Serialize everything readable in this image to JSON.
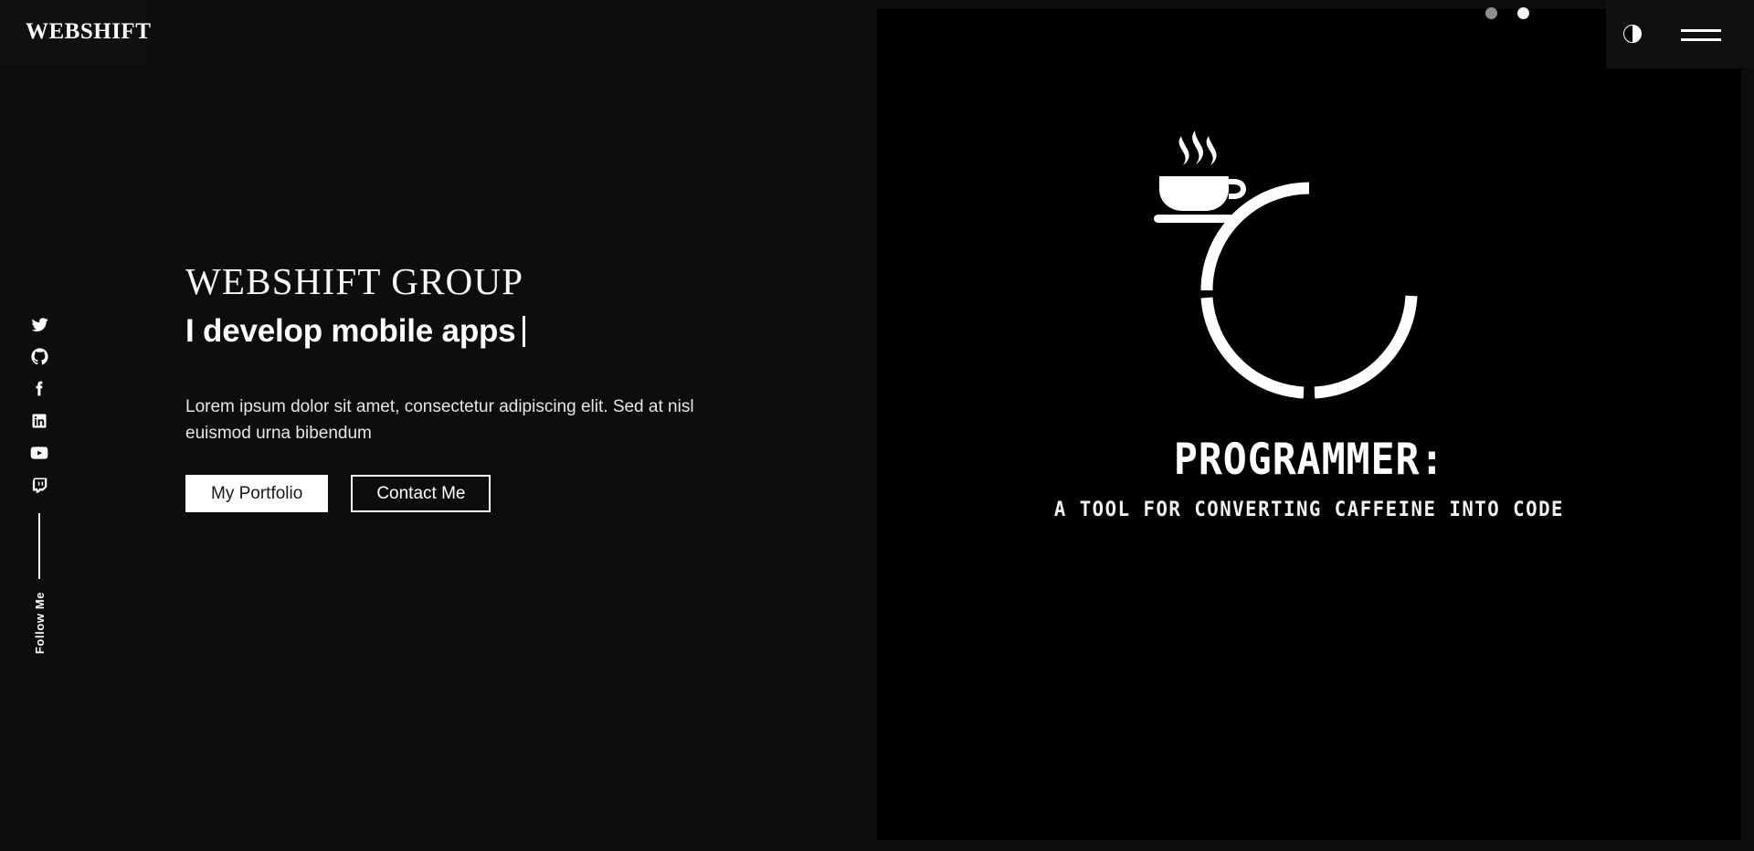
{
  "brand": {
    "logo_text": "WEBSHIFT"
  },
  "header": {
    "theme_toggle_icon": "contrast-toggle-icon",
    "menu_icon": "hamburger-menu-icon",
    "carousel_dots": [
      {
        "name": "carousel-dot-1",
        "active": false,
        "color": "#8d8d8d"
      },
      {
        "name": "carousel-dot-2",
        "active": true,
        "color": "#f2f2f2"
      }
    ]
  },
  "social": {
    "label": "Follow Me",
    "items": [
      {
        "name": "twitter",
        "icon": "twitter-icon"
      },
      {
        "name": "github",
        "icon": "github-icon"
      },
      {
        "name": "facebook",
        "icon": "facebook-icon"
      },
      {
        "name": "linkedin",
        "icon": "linkedin-icon"
      },
      {
        "name": "youtube",
        "icon": "youtube-icon"
      },
      {
        "name": "twitch",
        "icon": "twitch-icon"
      }
    ]
  },
  "hero": {
    "kicker": "WEBSHIFT GROUP",
    "typed_text": "I develop mobile apps",
    "description": "Lorem ipsum dolor sit amet, consectetur adipiscing elit. Sed at nisl euismod urna bibendum",
    "primary_button": "My Portfolio",
    "secondary_button": "Contact Me"
  },
  "stage": {
    "art_icon": "coffee-cup-in-ring-icon",
    "title": "PROGRAMMER:",
    "subtitle": "A TOOL FOR CONVERTING CAFFEINE INTO CODE"
  },
  "colors": {
    "page_background": "#0d0d0d",
    "stage_background": "#000000",
    "foreground": "#ffffff",
    "primary_button_bg": "#ffffff",
    "primary_button_text": "#18181a"
  }
}
